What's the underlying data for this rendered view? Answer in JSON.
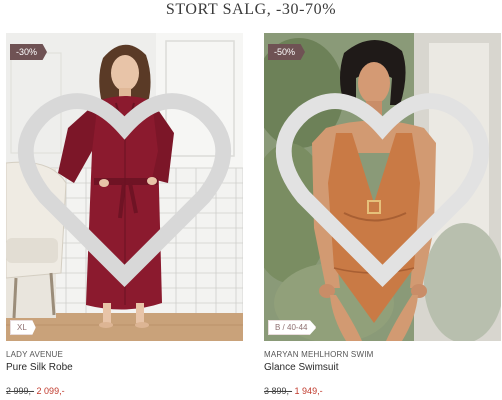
{
  "heading": "STORT SALG, -30-70%",
  "products": [
    {
      "brand": "LADY AVENUE",
      "name": "Pure Silk Robe",
      "discount": "-30%",
      "size": "XL",
      "old_price": "2 999,-",
      "new_price": "2 099,-",
      "wishlist_icon": "heart-icon"
    },
    {
      "brand": "MARYAN MEHLHORN SWIM",
      "name": "Glance Swimsuit",
      "discount": "-50%",
      "size": "B / 40-44",
      "old_price": "3 899,-",
      "new_price": "1 949,-",
      "wishlist_icon": "heart-icon"
    }
  ],
  "colors": {
    "badge": "#6f5254",
    "sale_price": "#c0392b",
    "robe": "#8b1a2e",
    "swimsuit": "#c97a45"
  }
}
